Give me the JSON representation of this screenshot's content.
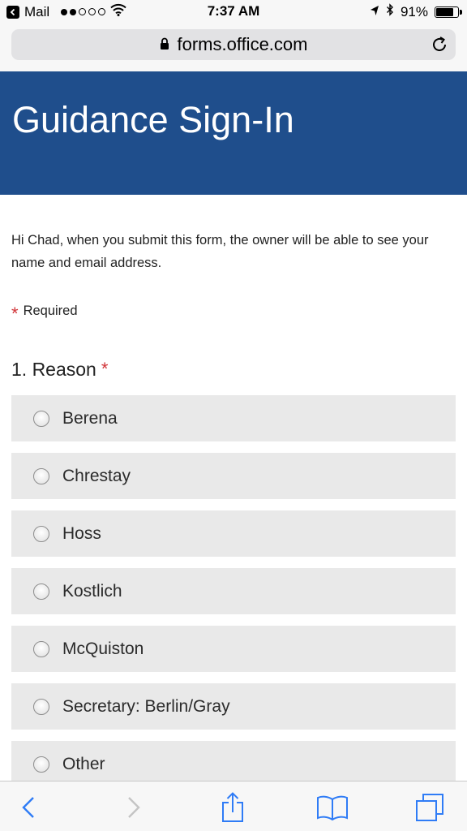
{
  "status_bar": {
    "back_app": "Mail",
    "time": "7:37 AM",
    "battery": "91%",
    "battery_level": 0.91
  },
  "browser": {
    "url": "forms.office.com"
  },
  "form": {
    "title": "Guidance Sign-In",
    "intro": "Hi Chad, when you submit this form, the owner will be able to see your name and email address.",
    "required_mark": "*",
    "required_label": "Required",
    "question": {
      "label": "1. Reason",
      "options": [
        "Berena",
        "Chrestay",
        "Hoss",
        "Kostlich",
        "McQuiston",
        "Secretary: Berlin/Gray",
        "Other"
      ]
    }
  },
  "toolbar": {
    "icons": [
      "back-icon",
      "forward-icon",
      "share-icon",
      "bookmarks-icon",
      "tabs-icon"
    ]
  },
  "colors": {
    "banner": "#1f4e8c",
    "required": "#d13438",
    "ios_blue": "#2f7cf6",
    "option_bg": "#e9e9e9"
  }
}
